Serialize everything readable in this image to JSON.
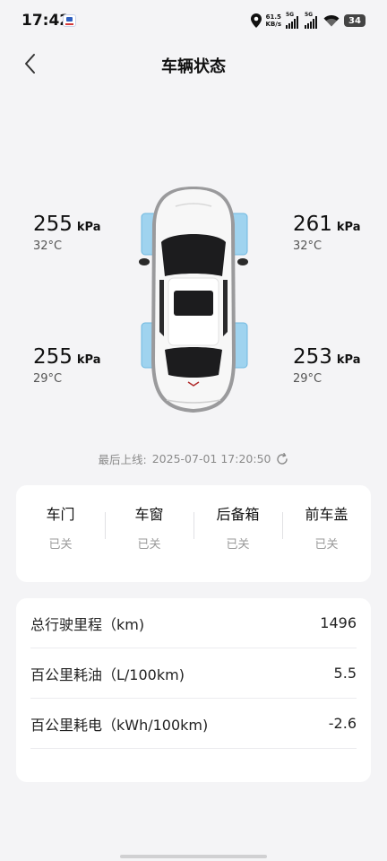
{
  "status_bar": {
    "time": "17:42",
    "net_speed_value": "61.5",
    "net_speed_unit": "KB/s",
    "sim1_label": "5G",
    "sim2_label": "5G",
    "battery_level": "34"
  },
  "header": {
    "title": "车辆状态"
  },
  "tires": {
    "front_left": {
      "pressure": "255",
      "unit": "kPa",
      "temp": "32°C"
    },
    "front_right": {
      "pressure": "261",
      "unit": "kPa",
      "temp": "32°C"
    },
    "rear_left": {
      "pressure": "255",
      "unit": "kPa",
      "temp": "29°C"
    },
    "rear_right": {
      "pressure": "253",
      "unit": "kPa",
      "temp": "29°C"
    },
    "highlight_color": "#9fd3ef"
  },
  "last_online": {
    "label": "最后上线:",
    "datetime": "2025-07-01 17:20:50"
  },
  "body_status": [
    {
      "label": "车门",
      "value": "已关"
    },
    {
      "label": "车窗",
      "value": "已关"
    },
    {
      "label": "后备箱",
      "value": "已关"
    },
    {
      "label": "前车盖",
      "value": "已关"
    }
  ],
  "stats": [
    {
      "label": "总行驶里程（km)",
      "value": "1496"
    },
    {
      "label": "百公里耗油（L/100km)",
      "value": "5.5"
    },
    {
      "label": "百公里耗电（kWh/100km)",
      "value": "-2.6"
    }
  ]
}
